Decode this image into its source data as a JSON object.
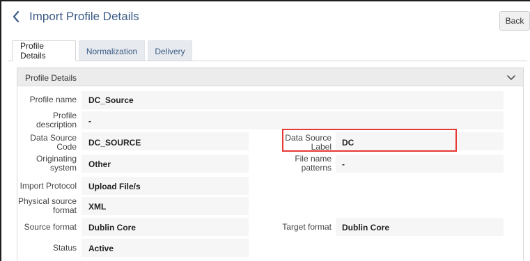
{
  "header": {
    "title": "Import Profile Details",
    "back_label": "Back"
  },
  "tabs": [
    {
      "label": "Profile Details"
    },
    {
      "label": "Normalization"
    },
    {
      "label": "Delivery"
    }
  ],
  "panel": {
    "title": "Profile Details"
  },
  "fields": {
    "profile_name": {
      "label": "Profile name",
      "value": "DC_Source"
    },
    "profile_description": {
      "label_1": "Profile",
      "label_2": "description",
      "value": "-"
    },
    "data_source_code": {
      "label_1": "Data Source",
      "label_2": "Code",
      "value": "DC_SOURCE"
    },
    "data_source_label": {
      "label_1": "Data Source",
      "label_2": "Label",
      "value": "DC"
    },
    "originating_system": {
      "label_1": "Originating",
      "label_2": "system",
      "value": "Other"
    },
    "file_name_patterns": {
      "label_1": "File name",
      "label_2": "patterns",
      "value": "-"
    },
    "import_protocol": {
      "label": "Import Protocol",
      "value": "Upload File/s"
    },
    "physical_source_format": {
      "label_1": "Physical source",
      "label_2": "format",
      "value": "XML"
    },
    "source_format": {
      "label": "Source format",
      "value": "Dublin Core"
    },
    "target_format": {
      "label": "Target format",
      "value": "Dublin Core"
    },
    "status": {
      "label": "Status",
      "value": "Active"
    }
  },
  "icons": {
    "back": "chevron-left-icon",
    "collapse": "chevron-down-icon"
  },
  "colors": {
    "title": "#3b5b86",
    "highlight": "#e53935"
  }
}
